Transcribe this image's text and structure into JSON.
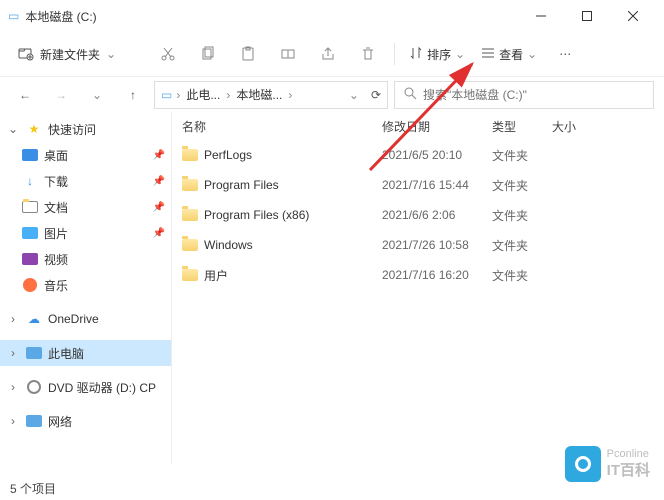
{
  "window": {
    "title": "本地磁盘 (C:)"
  },
  "cmdbar": {
    "new_folder": "新建文件夹",
    "sort": "排序",
    "view": "查看"
  },
  "breadcrumb": {
    "crumb1": "此电...",
    "crumb2": "本地磁..."
  },
  "search": {
    "placeholder": "搜索\"本地磁盘 (C:)\""
  },
  "columns": {
    "name": "名称",
    "date": "修改日期",
    "type": "类型",
    "size": "大小"
  },
  "sidebar": {
    "quick": "快速访问",
    "desktop": "桌面",
    "downloads": "下载",
    "documents": "文档",
    "pictures": "图片",
    "videos": "视频",
    "music": "音乐",
    "onedrive": "OneDrive",
    "thispc": "此电脑",
    "dvd": "DVD 驱动器 (D:) CP",
    "network": "网络"
  },
  "rows": [
    {
      "name": "PerfLogs",
      "date": "2021/6/5 20:10",
      "type": "文件夹"
    },
    {
      "name": "Program Files",
      "date": "2021/7/16 15:44",
      "type": "文件夹"
    },
    {
      "name": "Program Files (x86)",
      "date": "2021/6/6 2:06",
      "type": "文件夹"
    },
    {
      "name": "Windows",
      "date": "2021/7/26 10:58",
      "type": "文件夹"
    },
    {
      "name": "用户",
      "date": "2021/7/16 16:20",
      "type": "文件夹"
    }
  ],
  "status": {
    "count": "5 个项目"
  },
  "watermark": {
    "top": "Pconline",
    "bottom": "IT百科"
  }
}
